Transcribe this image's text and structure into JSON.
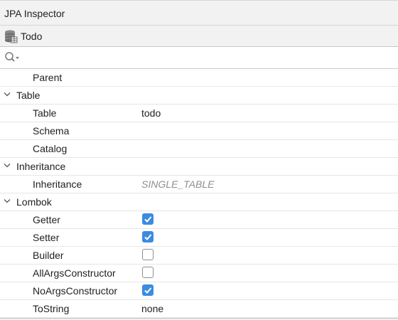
{
  "window": {
    "title": "JPA Inspector"
  },
  "entity": {
    "name": "Todo",
    "icon": "database-icon"
  },
  "search": {
    "placeholder": "",
    "value": ""
  },
  "rows": [
    {
      "kind": "prop",
      "label": "Parent",
      "value": ""
    },
    {
      "kind": "group",
      "label": "Table"
    },
    {
      "kind": "prop",
      "label": "Table",
      "value": "todo"
    },
    {
      "kind": "prop",
      "label": "Schema",
      "value": ""
    },
    {
      "kind": "prop",
      "label": "Catalog",
      "value": ""
    },
    {
      "kind": "group",
      "label": "Inheritance"
    },
    {
      "kind": "prop",
      "label": "Inheritance",
      "value": "SINGLE_TABLE",
      "style": "placeholder"
    },
    {
      "kind": "group",
      "label": "Lombok"
    },
    {
      "kind": "check",
      "label": "Getter",
      "checked": true
    },
    {
      "kind": "check",
      "label": "Setter",
      "checked": true
    },
    {
      "kind": "check",
      "label": "Builder",
      "checked": false
    },
    {
      "kind": "check",
      "label": "AllArgsConstructor",
      "checked": false
    },
    {
      "kind": "check",
      "label": "NoArgsConstructor",
      "checked": true
    },
    {
      "kind": "prop",
      "label": "ToString",
      "value": "none"
    }
  ],
  "colors": {
    "accent": "#3c8be0",
    "placeholder_text": "#8f8f8f"
  }
}
